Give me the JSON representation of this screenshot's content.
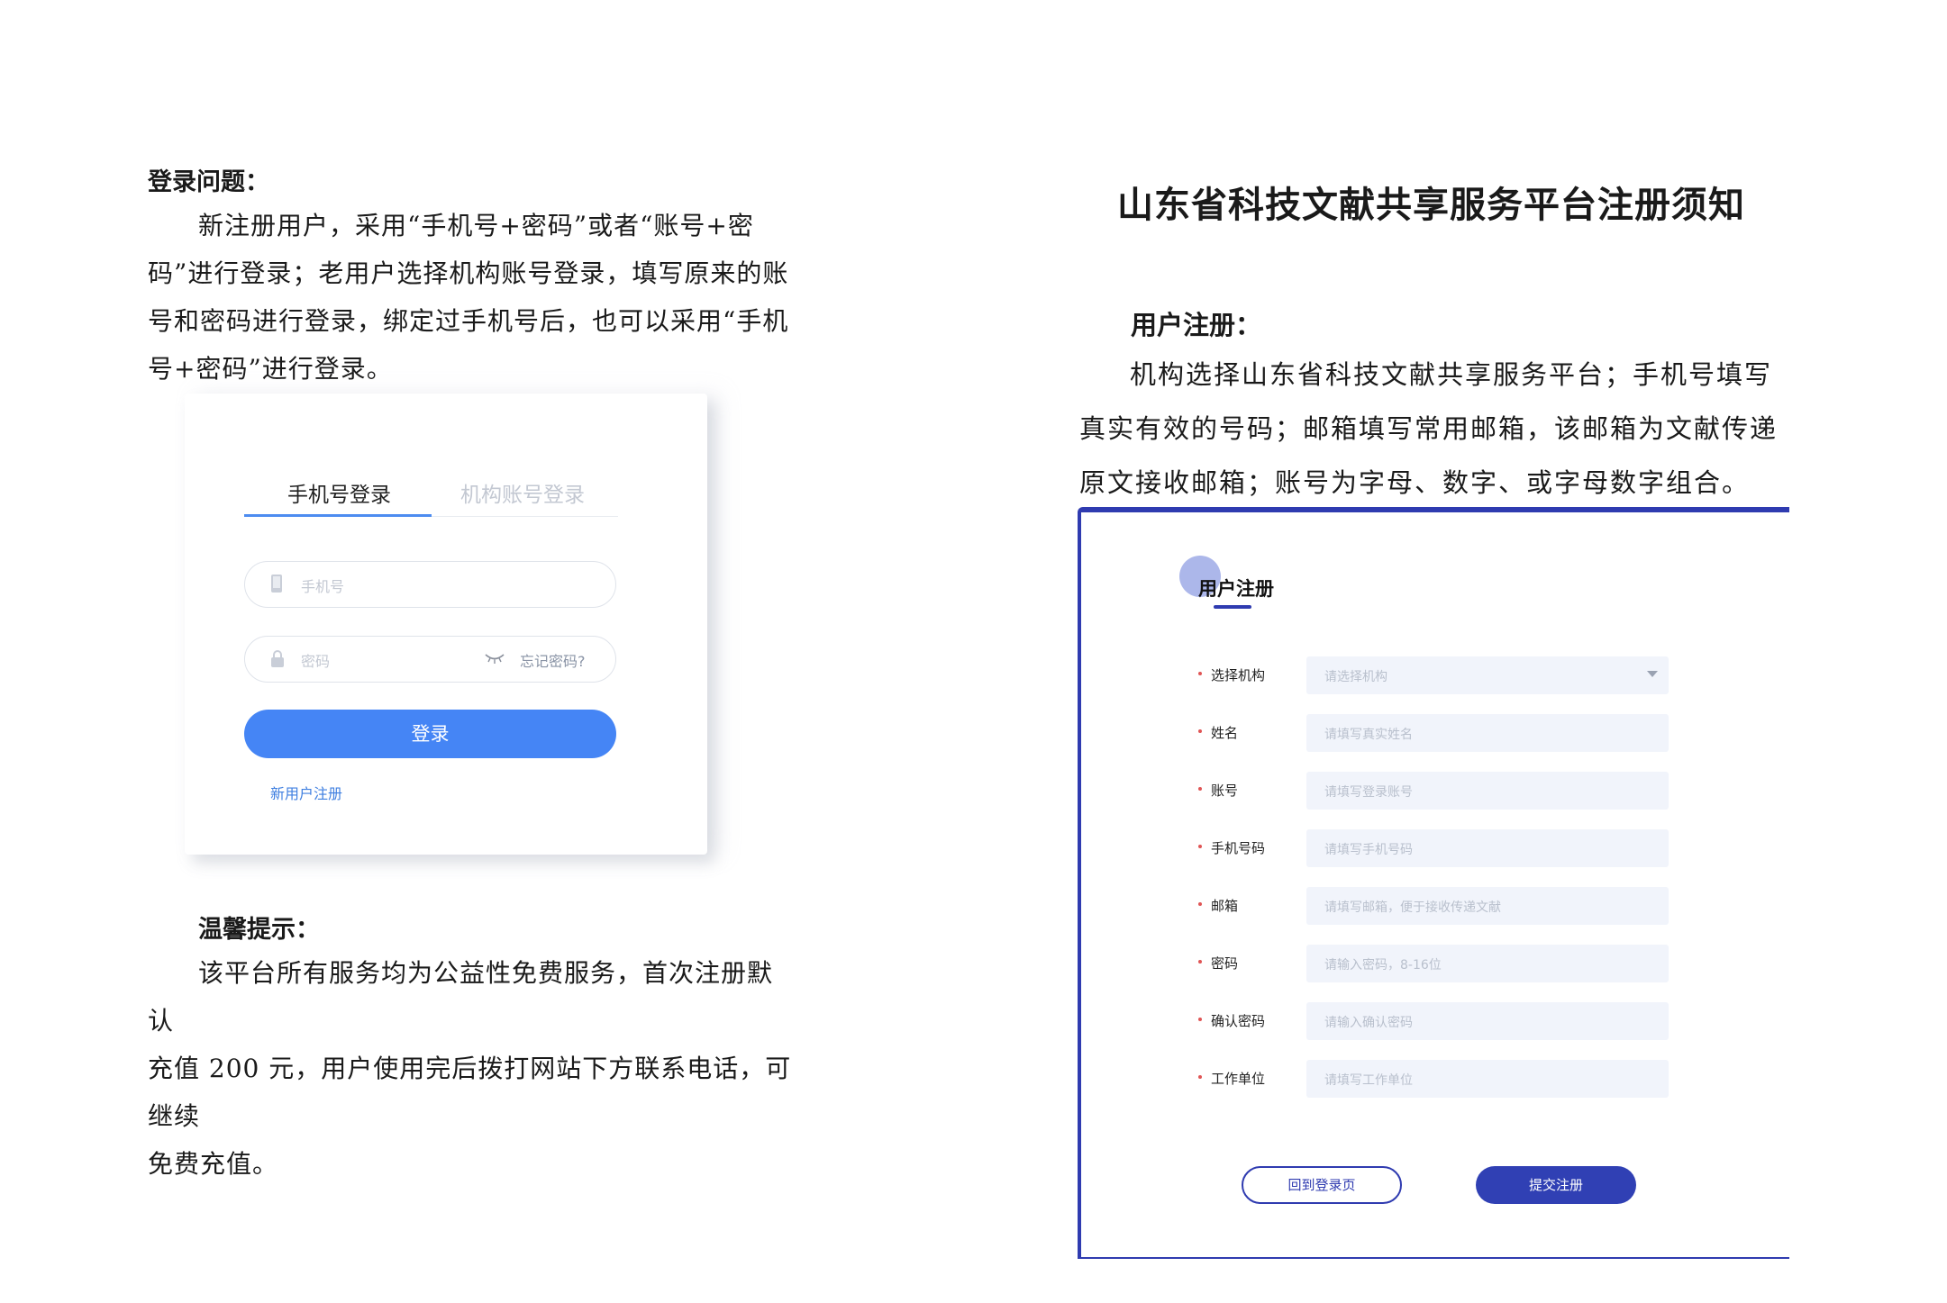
{
  "left": {
    "login_heading": "登录问题：",
    "login_paragraph_lines": [
      "新注册用户，采用“手机号+密码”或者“账号+密",
      "码”进行登录；老用户选择机构账号登录，填写原来的账",
      "号和密码进行登录，绑定过手机号后，也可以采用“手机",
      "号+密码”进行登录。"
    ],
    "login_card": {
      "tab_phone": "手机号登录",
      "tab_org": "机构账号登录",
      "phone_placeholder": "手机号",
      "password_placeholder": "密码",
      "forgot_password": "忘记密码?",
      "login_button": "登录",
      "register_link": "新用户注册"
    },
    "tip_heading": "温馨提示：",
    "tip_paragraph_lines": [
      "该平台所有服务均为公益性免费服务，首次注册默认",
      "充值 200 元，用户使用完后拨打网站下方联系电话，可继续",
      "免费充值。"
    ]
  },
  "right": {
    "title": "山东省科技文献共享服务平台注册须知",
    "reg_heading": "用户注册：",
    "reg_paragraph_lines": [
      "机构选择山东省科技文献共享服务平台；手机号填写",
      "真实有效的号码；邮箱填写常用邮箱，该邮箱为文献传递",
      "原文接收邮箱；账号为字母、数字、或字母数字组合。"
    ],
    "form": {
      "title": "用户注册",
      "fields": [
        {
          "label": "选择机构",
          "placeholder": "请选择机构"
        },
        {
          "label": "姓名",
          "placeholder": "请填写真实姓名"
        },
        {
          "label": "账号",
          "placeholder": "请填写登录账号"
        },
        {
          "label": "手机号码",
          "placeholder": "请填写手机号码"
        },
        {
          "label": "邮箱",
          "placeholder": "请填写邮箱，便于接收传递文献"
        },
        {
          "label": "密码",
          "placeholder": "请输入密码，8-16位"
        },
        {
          "label": "确认密码",
          "placeholder": "请输入确认密码"
        },
        {
          "label": "工作单位",
          "placeholder": "请填写工作单位"
        }
      ],
      "back_button": "回到登录页",
      "submit_button": "提交注册"
    }
  },
  "colors": {
    "login_blue": "#4585f5",
    "form_indigo": "#2f3bb0"
  }
}
